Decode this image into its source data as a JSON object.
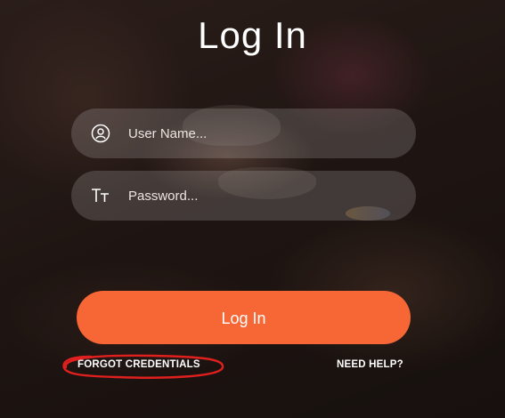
{
  "page": {
    "title": "Log In"
  },
  "form": {
    "username_placeholder": "User Name...",
    "password_placeholder": "Password...",
    "submit_label": "Log In"
  },
  "links": {
    "forgot": "FORGOT CREDENTIALS",
    "help": "NEED HELP?"
  },
  "colors": {
    "accent": "#f76635",
    "annotation": "#e0201e"
  },
  "icons": {
    "username": "user-circle-icon",
    "password": "text-size-icon"
  }
}
